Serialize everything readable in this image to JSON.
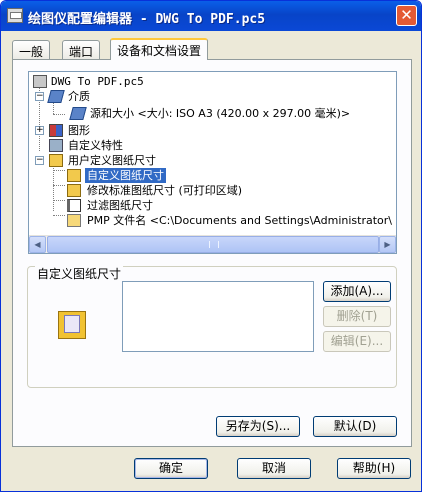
{
  "window": {
    "title": "绘图仪配置编辑器 - DWG To PDF.pc5",
    "close_glyph": "✕"
  },
  "tabs": [
    {
      "label": "一般",
      "active": false
    },
    {
      "label": "端口",
      "active": false
    },
    {
      "label": "设备和文档设置",
      "active": true
    }
  ],
  "tree": {
    "items": [
      {
        "label": "DWG To PDF.pc5",
        "icon": "printer-icon"
      },
      {
        "label": "介质",
        "icon": "media-icon",
        "expander": "−"
      },
      {
        "label": "源和大小 <大小: ISO A3 (420.00 x 297.00 毫米)>",
        "icon": "paper-source-icon"
      },
      {
        "label": "图形",
        "icon": "graphics-icon",
        "expander": "+"
      },
      {
        "label": "自定义特性",
        "icon": "custom-properties-icon"
      },
      {
        "label": "用户定义图纸尺寸",
        "icon": "user-defined-paper-icon",
        "expander": "−"
      },
      {
        "label": "自定义图纸尺寸",
        "icon": "custom-paper-size-icon",
        "selected": true
      },
      {
        "label": "修改标准图纸尺寸 (可打印区域)",
        "icon": "modify-paper-icon"
      },
      {
        "label": "过滤图纸尺寸",
        "icon": "filter-paper-icon"
      },
      {
        "label": "PMP 文件名 <C:\\Documents and Settings\\Administrator\\",
        "icon": "pmp-file-icon"
      }
    ],
    "scroll": {
      "left_glyph": "◀",
      "right_glyph": "▶"
    }
  },
  "group": {
    "title": "自定义图纸尺寸",
    "buttons": {
      "add": "添加(A)...",
      "delete": "删除(T)",
      "edit": "编辑(E)..."
    }
  },
  "panel_buttons": {
    "save_as": "另存为(S)...",
    "default": "默认(D)"
  },
  "dialog_buttons": {
    "ok": "确定",
    "cancel": "取消",
    "help": "帮助(H)"
  },
  "colors": {
    "title_bar": "#0a5fe8",
    "selection": "#316ac5",
    "dialog_bg": "#ece9d8",
    "active_tab_accent": "#ffc83c"
  }
}
